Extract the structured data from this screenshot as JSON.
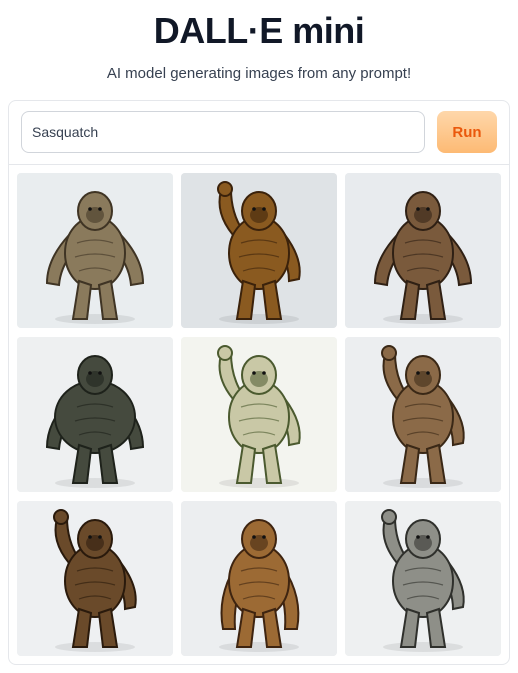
{
  "header": {
    "title": "DALL·E mini",
    "subtitle": "AI model generating images from any prompt!"
  },
  "prompt": {
    "value": "Sasquatch",
    "run_label": "Run"
  },
  "gallery": {
    "images": [
      {
        "name": "sasquatch-image-1",
        "bg": "#e9edef",
        "fur": "#8a7a5c",
        "dark": "#3f3424",
        "pose": "stand"
      },
      {
        "name": "sasquatch-image-2",
        "bg": "#dfe3e6",
        "fur": "#8a5a20",
        "dark": "#3b220b",
        "pose": "wave"
      },
      {
        "name": "sasquatch-image-3",
        "bg": "#e8ebee",
        "fur": "#7a5a3c",
        "dark": "#2f2014",
        "pose": "stand"
      },
      {
        "name": "sasquatch-image-4",
        "bg": "#eef0f1",
        "fur": "#454a3e",
        "dark": "#1e221b",
        "pose": "bulk"
      },
      {
        "name": "sasquatch-image-5",
        "bg": "#f3f4ef",
        "fur": "#c9c8a6",
        "dark": "#4b5a2f",
        "pose": "wave"
      },
      {
        "name": "sasquatch-image-6",
        "bg": "#eceef0",
        "fur": "#8b6a48",
        "dark": "#3a2816",
        "pose": "wave"
      },
      {
        "name": "sasquatch-image-7",
        "bg": "#eef0f2",
        "fur": "#6a4a2a",
        "dark": "#2a1a0c",
        "pose": "wave"
      },
      {
        "name": "sasquatch-image-8",
        "bg": "#eceef0",
        "fur": "#9c6a34",
        "dark": "#3e2410",
        "pose": "crouch"
      },
      {
        "name": "sasquatch-image-9",
        "bg": "#eef0f1",
        "fur": "#8e8f88",
        "dark": "#2f302c",
        "pose": "wave"
      }
    ]
  }
}
